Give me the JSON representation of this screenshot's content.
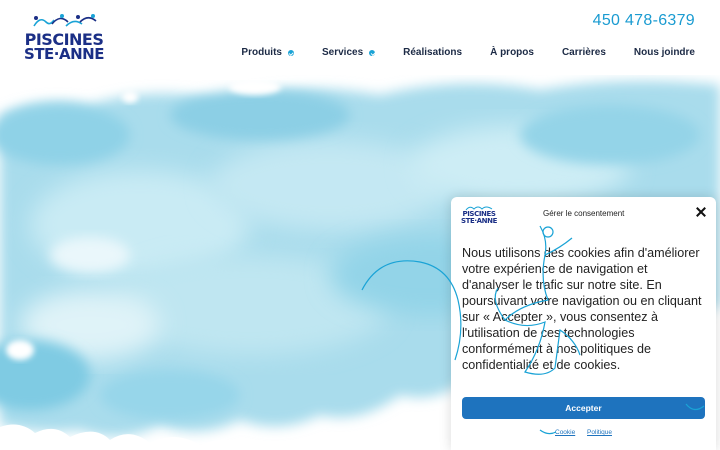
{
  "brand": {
    "logo_line1": "PISCINES",
    "logo_line2": "STE·ANNE",
    "logo_icon": "swimmers-icon",
    "primary_color": "#1b2f86",
    "accent_color": "#1aa3d6"
  },
  "header": {
    "phone": "450 478-6379"
  },
  "nav": {
    "items": [
      {
        "label": "Produits",
        "has_dropdown": true
      },
      {
        "label": "Services",
        "has_dropdown": true
      },
      {
        "label": "Réalisations",
        "has_dropdown": false
      },
      {
        "label": "À propos",
        "has_dropdown": false
      },
      {
        "label": "Carrières",
        "has_dropdown": false
      },
      {
        "label": "Nous joindre",
        "has_dropdown": false
      }
    ]
  },
  "cookie": {
    "title": "Gérer le consentement",
    "body": "Nous utilisons des cookies afin d'améliorer votre expérience de navigation et d'analyser le trafic sur notre site. En poursuivant votre navigation ou en cliquant sur « Accepter », vous consentez à l'utilisation de ces technologies conformément à nos politiques de confidentialité et de cookies.",
    "accept_label": "Accepter",
    "link_cookie": "Cookie",
    "link_policy": "Politique",
    "button_color": "#1e73be"
  }
}
